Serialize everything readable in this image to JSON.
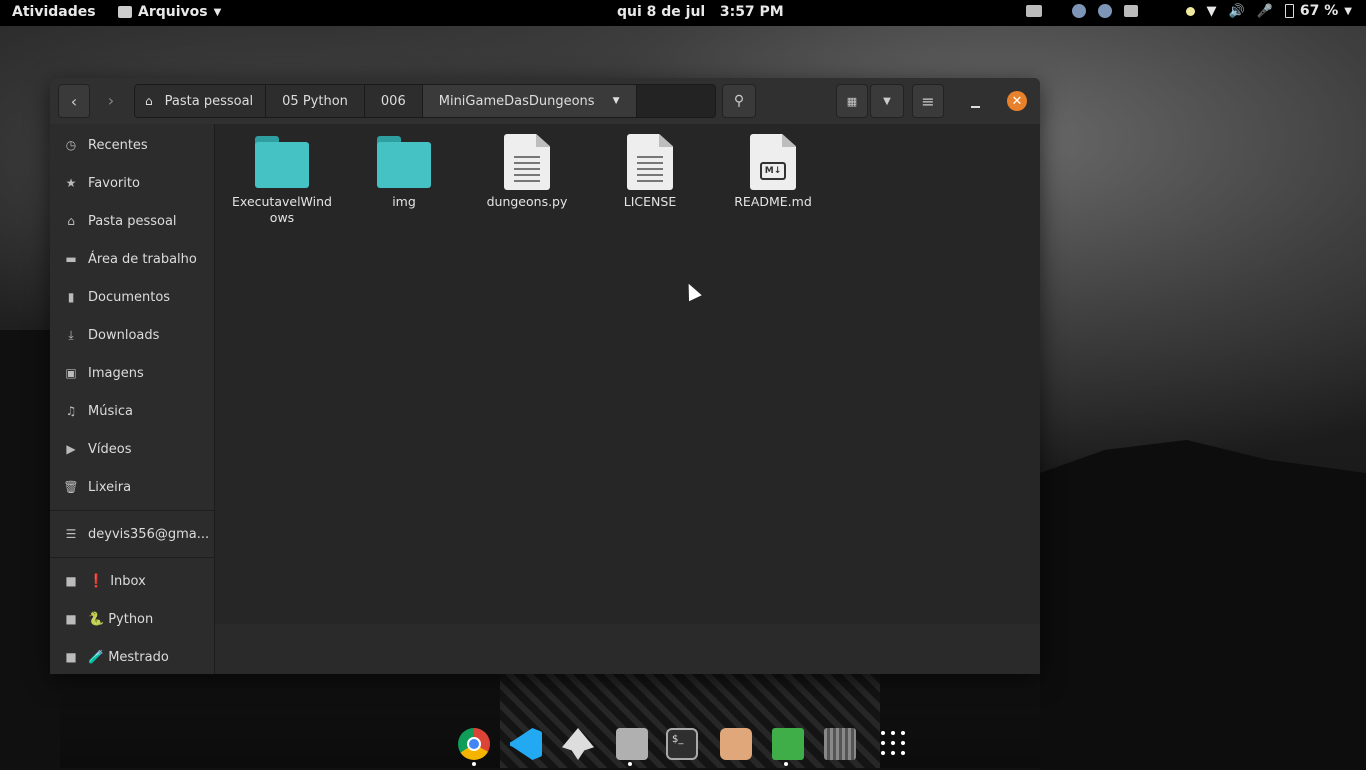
{
  "topbar": {
    "activities": "Atividades",
    "app_name": "Arquivos",
    "clock": "qui 8 de jul   3:57 PM",
    "battery": "67 %"
  },
  "headerbar": {
    "breadcrumbs": [
      "Pasta pessoal",
      "05 Python",
      "006",
      "MiniGameDasDungeons"
    ]
  },
  "sidebar": {
    "places": [
      {
        "label": "Recentes",
        "icon": "clock-icon"
      },
      {
        "label": "Favorito",
        "icon": "star-icon"
      },
      {
        "label": "Pasta pessoal",
        "icon": "home-icon"
      },
      {
        "label": "Área de trabalho",
        "icon": "desktop-icon"
      },
      {
        "label": "Documentos",
        "icon": "document-icon"
      },
      {
        "label": "Downloads",
        "icon": "download-icon"
      },
      {
        "label": "Imagens",
        "icon": "image-icon"
      },
      {
        "label": "Música",
        "icon": "music-icon"
      },
      {
        "label": "Vídeos",
        "icon": "video-icon"
      },
      {
        "label": "Lixeira",
        "icon": "trash-icon"
      }
    ],
    "account": {
      "label": "deyvis356@gma...",
      "icon": "network-drive-icon"
    },
    "bookmarks": [
      {
        "label": "Inbox",
        "emoji": "❗"
      },
      {
        "label": "Python",
        "emoji": "🐍"
      },
      {
        "label": "Mestrado",
        "emoji": "🧪"
      }
    ]
  },
  "files": [
    {
      "name": "ExecutavelWindows",
      "type": "folder"
    },
    {
      "name": "img",
      "type": "folder"
    },
    {
      "name": "dungeons.py",
      "type": "text"
    },
    {
      "name": "LICENSE",
      "type": "text"
    },
    {
      "name": "README.md",
      "type": "markdown",
      "badge": "M↓"
    }
  ],
  "colors": {
    "folder": "#45c3c4",
    "close_button": "#e8812b"
  }
}
